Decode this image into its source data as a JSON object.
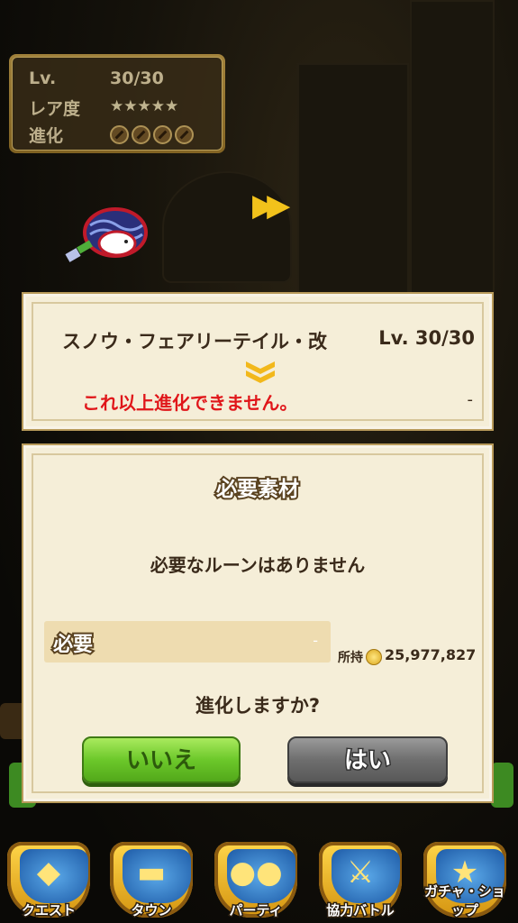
{
  "status": {
    "lv_label": "Lv.",
    "lv_value": "30/30",
    "rarity_label": "レア度",
    "rarity_stars": "★★★★★",
    "evo_label": "進化"
  },
  "info": {
    "monster_name": "スノウ・フェアリーテイル・改",
    "monster_level": "Lv. 30/30",
    "cannot_evolve": "これ以上進化できません。",
    "dash": "-"
  },
  "materials": {
    "title": "必要素材",
    "no_rune": "必要なルーンはありません",
    "need_label": "必要",
    "need_value": "-",
    "owned_label": "所持",
    "owned_value": "25,977,827",
    "confirm": "進化しますか?",
    "no_button": "いいえ",
    "yes_button": "はい"
  },
  "nav": [
    {
      "label": "クエスト",
      "icon": "quest-map-icon"
    },
    {
      "label": "タウン",
      "icon": "town-icon"
    },
    {
      "label": "パーティ",
      "icon": "party-icon"
    },
    {
      "label": "協力バトル",
      "icon": "coop-battle-icon"
    },
    {
      "label": "ガチャ・ショップ",
      "icon": "gacha-star-icon"
    }
  ],
  "colors": {
    "accent_gold": "#f2c21b",
    "warning_red": "#e0161a",
    "no_button_green": "#6cc82a",
    "yes_button_gray": "#6e6e6e"
  }
}
